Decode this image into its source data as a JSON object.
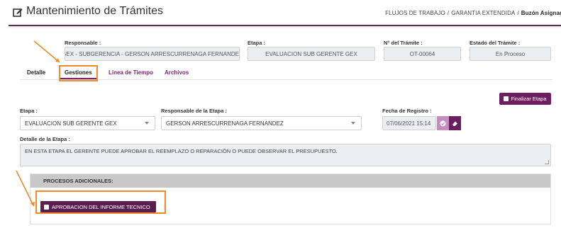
{
  "header": {
    "title": "Mantenimiento de Trámites",
    "title_icon": "edit-icon",
    "breadcrumb": {
      "item1": "FLUJOS DE TRABAJO",
      "item2": "GARANTIA EXTENDIDA",
      "current": "Buzón Asignado",
      "separator": "/"
    }
  },
  "summary": {
    "responsable_label": "Responsable :",
    "responsable_value": "GEX - SUBGERENCIA - GERSON ARRESCURRENAGA FERNANDEZ",
    "etapa_label": "Etapa :",
    "etapa_value": "EVALUACION SUB GERENTE GEX",
    "numero_label": "N° del Trámite :",
    "numero_value": "OT-00064",
    "estado_label": "Estado del Trámite :",
    "estado_value": "En Proceso"
  },
  "tabs": [
    {
      "label": "Detalle",
      "active": false
    },
    {
      "label": "Gestiones",
      "active": true
    },
    {
      "label": "Linea de Tiempo",
      "active": false
    },
    {
      "label": "Archivos",
      "active": false
    }
  ],
  "gestion": {
    "finalizar_label": "Finalizar Etapa",
    "finalizar_icon": "check-square-icon",
    "etapa_label": "Etapa :",
    "etapa_selected": "EVALUACION SUB GERENTE GEX",
    "responsable_label": "Responsable de la Etapa :",
    "responsable_selected": "GERSON ARRESCURRENAGA FERNANDEZ",
    "fecha_label": "Fecha de Registro :",
    "fecha_value": "07/06/2021 15:14",
    "detalle_label": "Detalle de la Etapa :",
    "detalle_value": "EN ESTA ETAPA EL GERENTE PUEDE APROBAR EL REEMPLAZO O REPARACIÓN O PUEDE OBSERVAR EL PRESUPUESTO."
  },
  "procesos": {
    "header": "PROCESOS ADICIONALES:",
    "button_label": "APROBACION DEL INFORME TECNICO",
    "button_icon": "check-square-icon"
  },
  "colors": {
    "primary": "#6b1f5e",
    "highlight": "#f08a2a",
    "header_line": "#5e2a5a"
  }
}
